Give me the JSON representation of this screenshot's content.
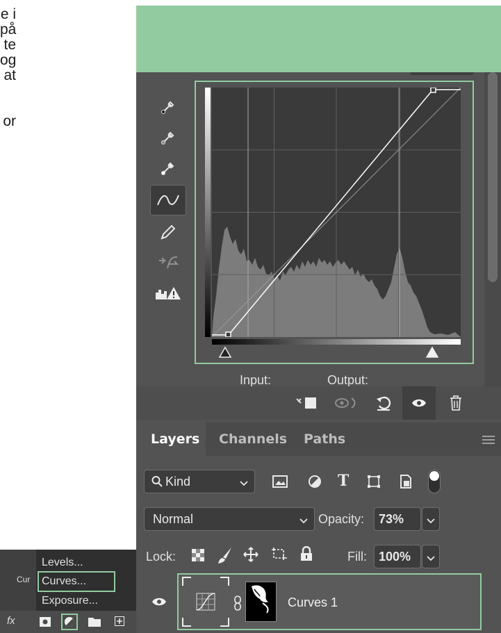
{
  "doc_text": {
    "lines": [
      "e i",
      "på",
      "te",
      "og",
      "at",
      "",
      "",
      "or"
    ]
  },
  "curves": {
    "tools": [
      "sample-black-eyedropper-icon",
      "sample-gray-eyedropper-icon",
      "sample-white-eyedropper-icon",
      "curve-edit-icon",
      "pencil-icon",
      "smooth-icon",
      "clipping-warning-icon"
    ],
    "input_label": "Input:",
    "output_label": "Output:"
  },
  "footer": {
    "buttons": [
      "clip-to-layer-icon",
      "view-previous-icon",
      "reset-icon",
      "visibility-icon",
      "delete-icon"
    ]
  },
  "layers_panel": {
    "tabs": [
      "Layers",
      "Channels",
      "Paths"
    ],
    "active_tab": "Layers",
    "filter_kind": "Kind",
    "blend_mode": "Normal",
    "opacity_label": "Opacity:",
    "opacity_value": "73%",
    "lock_label": "Lock:",
    "fill_label": "Fill:",
    "fill_value": "100%",
    "layer_name": "Curves 1"
  },
  "mini_menu": {
    "items": [
      "Levels...",
      "Curves...",
      "Exposure..."
    ],
    "selected": "Curves...",
    "left_stub": "Cur",
    "fx_label": "fx"
  },
  "colors": {
    "highlight": "#93cba0",
    "panel_bg": "#535353",
    "graph_bg": "#3a3a3a"
  }
}
